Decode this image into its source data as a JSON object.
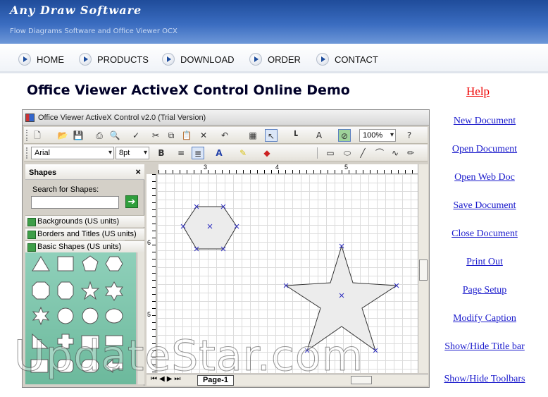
{
  "header": {
    "brand": "Any Draw Software",
    "tagline": "Flow Diagrams Software and Office Viewer OCX"
  },
  "nav": {
    "items": [
      "HOME",
      "PRODUCTS",
      "DOWNLOAD",
      "ORDER",
      "CONTACT"
    ]
  },
  "page": {
    "title": "Office Viewer ActiveX Control Online Demo",
    "help": "Help"
  },
  "links": [
    "New Document",
    "Open Document",
    "Open Web Doc",
    "Save Document",
    "Close Document",
    "Print Out",
    "Page Setup",
    "Modify Caption",
    "Show/Hide Title bar",
    "Show/Hide Toolbars"
  ],
  "app": {
    "title": "Office Viewer ActiveX Control v2.0 (Trial Version)",
    "zoom": "100%",
    "font": "Arial",
    "size": "8pt",
    "bold": "B",
    "font_color_label": "A",
    "text_tool_label": "A",
    "shapes": {
      "title": "Shapes",
      "close": "×",
      "search_label": "Search for Shapes:",
      "stencils": [
        "Backgrounds (US units)",
        "Borders and Titles (US units)",
        "Basic Shapes (US units)"
      ]
    },
    "ruler": {
      "h": [
        "3",
        "4",
        "5"
      ],
      "v": [
        "6",
        "5"
      ]
    },
    "page_tab": "Page-1"
  },
  "watermark": "UpdateStar.com",
  "colors": {
    "banner": "#2e5fb0",
    "help": "#e00000",
    "link": "#1a1acc",
    "palette": "#7dc5ab"
  }
}
